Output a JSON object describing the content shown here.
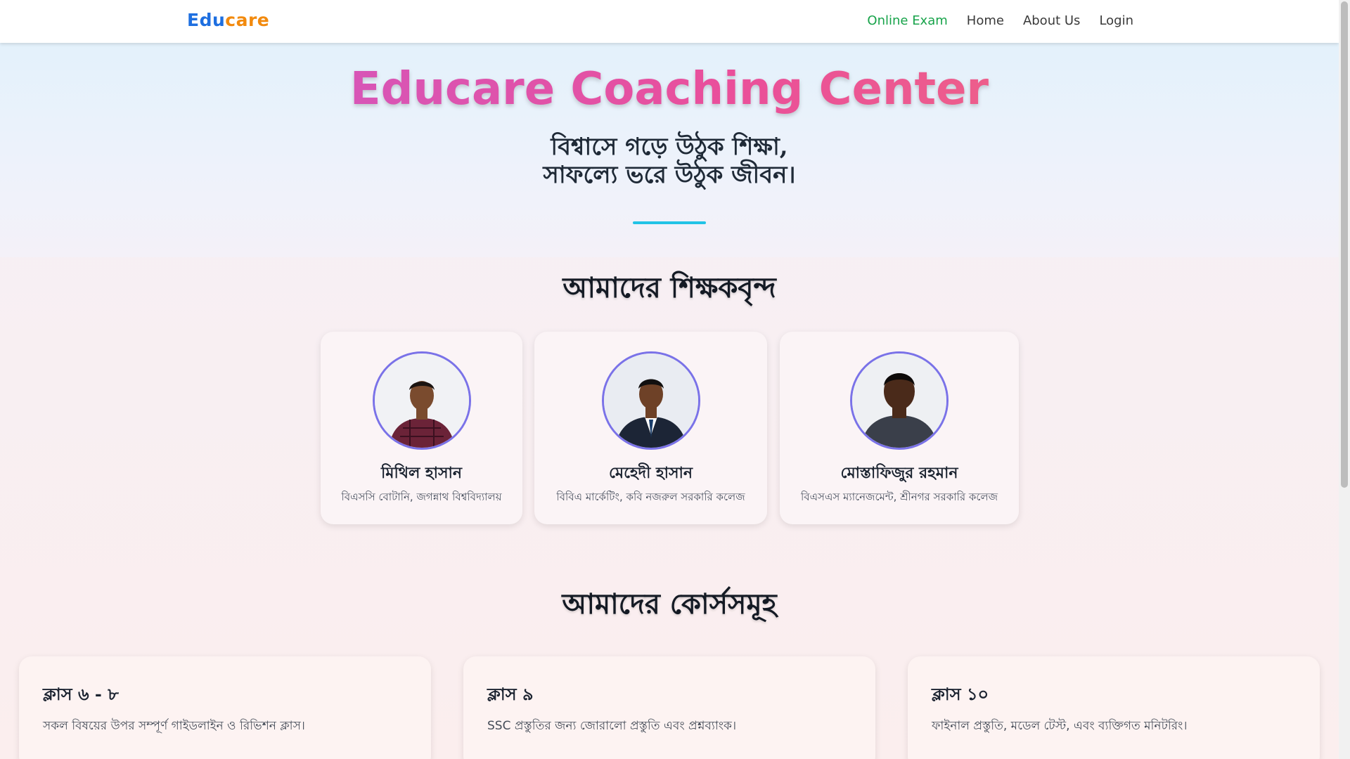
{
  "navbar": {
    "brand_part1": "Edu",
    "brand_part2": "care",
    "links": [
      {
        "label": "Online Exam"
      },
      {
        "label": "Home"
      },
      {
        "label": "About Us"
      },
      {
        "label": "Login"
      }
    ]
  },
  "hero": {
    "title": "Educare Coaching Center",
    "tagline_line1": "বিশ্বাসে গড়ে উঠুক শিক্ষা,",
    "tagline_line2": "সাফল্যে ভরে উঠুক জীবন।"
  },
  "teachers_section": {
    "heading": "আমাদের শিক্ষকবৃন্দ",
    "teachers": [
      {
        "name": "মিথিল হাসান",
        "desc": "বিএসসি বোটানি, জগন্নাথ বিশ্ববিদ্যালয়"
      },
      {
        "name": "মেহেদী হাসান",
        "desc": "বিবিএ মার্কেটিং, কবি নজরুল সরকারি কলেজ"
      },
      {
        "name": "মোস্তাফিজুর রহমান",
        "desc": "বিএসএস ম্যানেজমেন্ট, শ্রীনগর সরকারি কলেজ"
      }
    ]
  },
  "courses_section": {
    "heading": "আমাদের কোর্সসমূহ",
    "courses": [
      {
        "title": "ক্লাস ৬ - ৮",
        "desc": "সকল বিষয়ের উপর সম্পূর্ণ গাইডলাইন ও রিভিশন ক্লাস।"
      },
      {
        "title": "ক্লাস ৯",
        "desc": "SSC প্রস্তুতির জন্য জোরালো প্রস্তুতি এবং প্রশ্নব্যাংক।"
      },
      {
        "title": "ক্লাস ১০",
        "desc": "ফাইনাল প্রস্তুতি, মডেল টেস্ট, এবং ব্যক্তিগত মনিটরিং।"
      }
    ]
  },
  "colors": {
    "brand_blue": "#1e6fe0",
    "brand_orange": "#f28a0e",
    "active_link": "#17a34a",
    "avatar_border": "#7a72e8",
    "divider": "#22c3e6"
  }
}
